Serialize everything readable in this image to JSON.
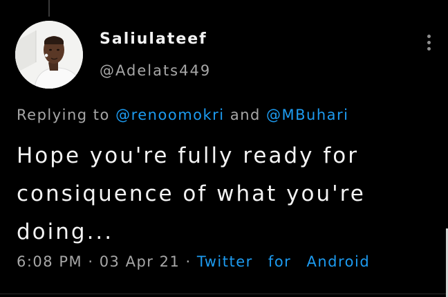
{
  "author": {
    "display_name": "Saliulateef",
    "handle": "@Adelats449"
  },
  "replying_to": {
    "prefix": "Replying to",
    "mention_1": "@renoomokri",
    "conjunction": "and",
    "mention_2": "@MBuhari"
  },
  "tweet": {
    "text": "Hope you're fully ready for consiquence of what you're doing..."
  },
  "meta": {
    "time": "6:08 PM",
    "separator": "·",
    "date": "03 Apr 21",
    "client": "Twitter for Android"
  },
  "icons": {
    "more": "more-vertical-icon"
  },
  "colors": {
    "background": "#000000",
    "link": "#1d9bf0",
    "secondary_text": "#a7a7a7",
    "primary_text": "#f4f4f4"
  }
}
